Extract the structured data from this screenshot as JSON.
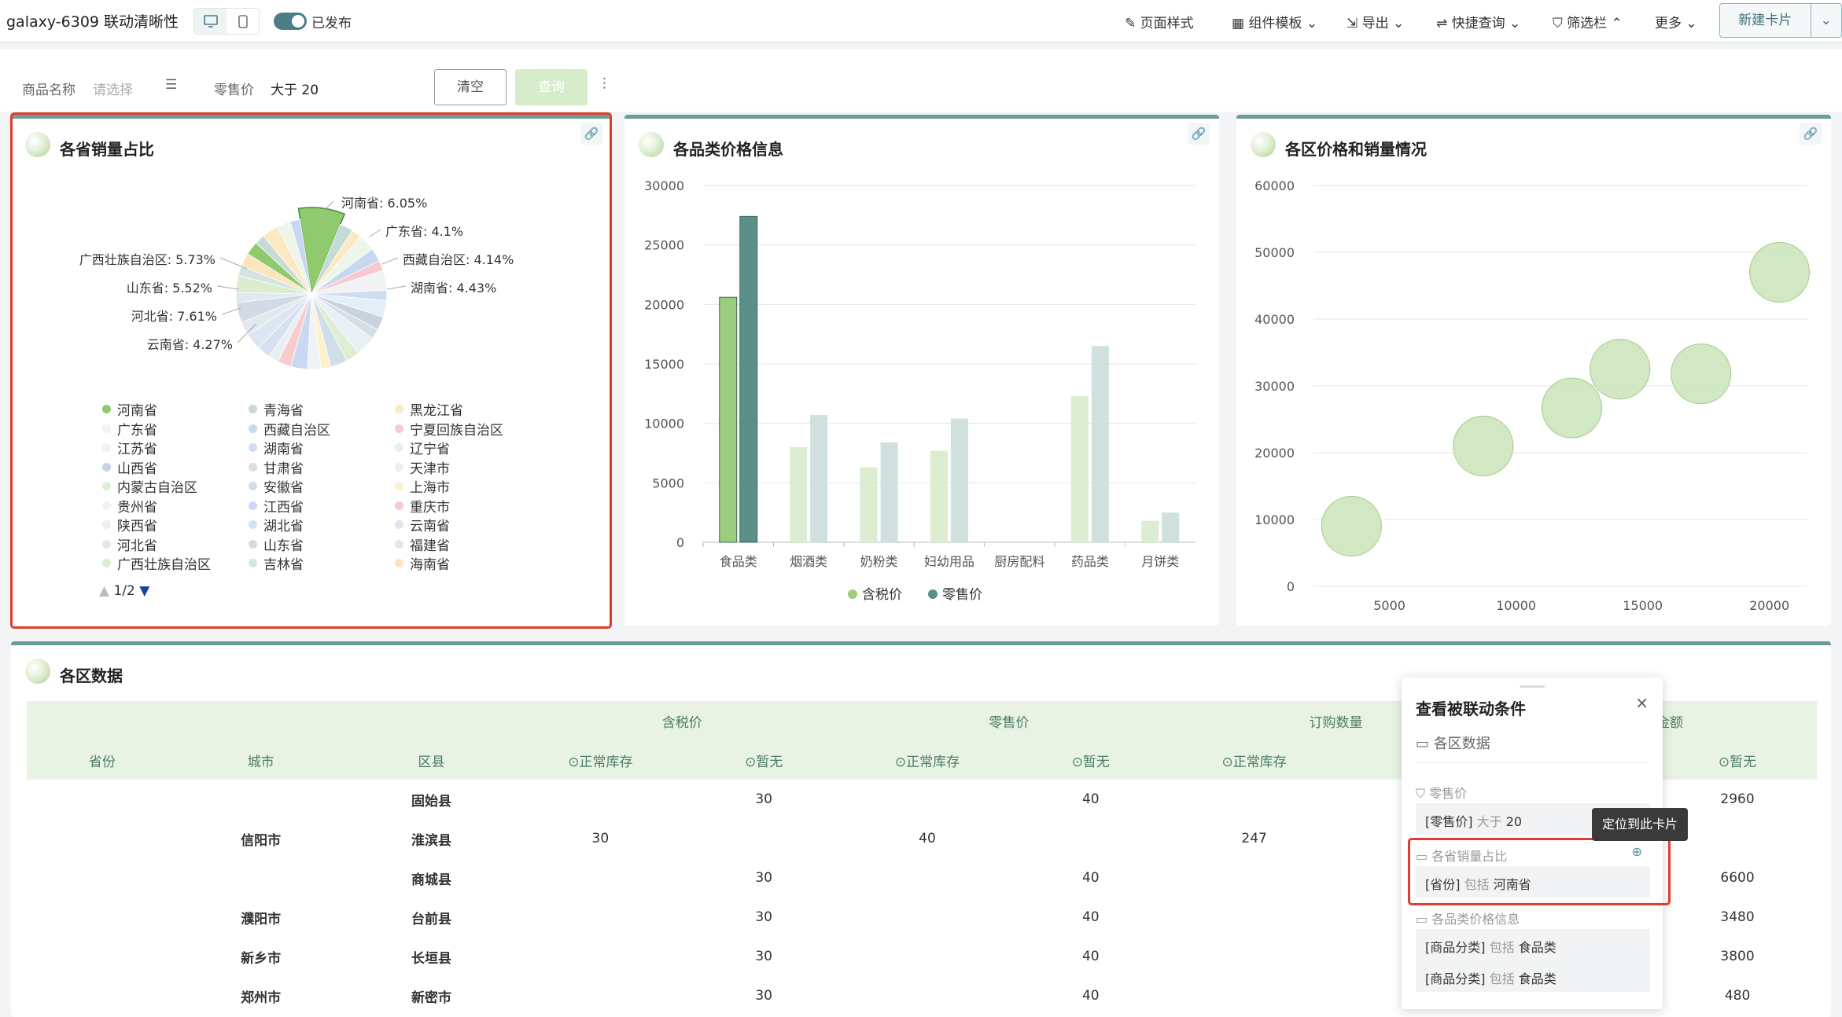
{
  "topbar": {
    "title": "galaxy-6309 联动清晰性",
    "publish_label": "已发布",
    "page_style": "页面样式",
    "component_template": "组件模板",
    "export": "导出",
    "quick_query": "快捷查询",
    "filter_bar": "筛选栏",
    "more": "更多",
    "new_card": "新建卡片"
  },
  "filters": {
    "product_name_label": "商品名称",
    "product_name_placeholder": "请选择",
    "retail_label": "零售价",
    "retail_value": "大于 20",
    "clear": "清空",
    "query": "查询"
  },
  "pie_card": {
    "title": "各省销量占比",
    "labels": [
      "河南省: 6.05%",
      "广东省: 4.1%",
      "西藏自治区: 4.14%",
      "湖南省: 4.43%",
      "广西壮族自治区: 5.73%",
      "山东省: 5.52%",
      "河北省: 7.61%",
      "云南省: 4.27%"
    ],
    "legend": [
      {
        "name": "河南省",
        "color": "#8fca6f"
      },
      {
        "name": "青海省",
        "color": "#c7dbd6"
      },
      {
        "name": "黑龙江省",
        "color": "#fce8c2"
      },
      {
        "name": "广东省",
        "color": "#eef5ea"
      },
      {
        "name": "西藏自治区",
        "color": "#c8d8f0"
      },
      {
        "name": "宁夏回族自治区",
        "color": "#f8c9cf"
      },
      {
        "name": "江苏省",
        "color": "#f0f2f3"
      },
      {
        "name": "湖南省",
        "color": "#cfdcf2"
      },
      {
        "name": "辽宁省",
        "color": "#e3eef6"
      },
      {
        "name": "山西省",
        "color": "#c8d3df"
      },
      {
        "name": "甘肃省",
        "color": "#d7dfe6"
      },
      {
        "name": "天津市",
        "color": "#e8f0f6"
      },
      {
        "name": "内蒙古自治区",
        "color": "#dcefd2"
      },
      {
        "name": "安徽省",
        "color": "#d0dee8"
      },
      {
        "name": "上海市",
        "color": "#fdf0cc"
      },
      {
        "name": "贵州省",
        "color": "#eff3f6"
      },
      {
        "name": "江西省",
        "color": "#c9d8f3"
      },
      {
        "name": "重庆市",
        "color": "#f6cccd"
      },
      {
        "name": "陕西省",
        "color": "#e9eff4"
      },
      {
        "name": "湖北省",
        "color": "#d5e1f0"
      },
      {
        "name": "云南省",
        "color": "#dbe6f2"
      },
      {
        "name": "河北省",
        "color": "#e1e9ef"
      },
      {
        "name": "山东省",
        "color": "#d2dbe5"
      },
      {
        "name": "福建省",
        "color": "#e0e8f0"
      },
      {
        "name": "广西壮族自治区",
        "color": "#dbeccf"
      },
      {
        "name": "吉林省",
        "color": "#d4e4e0"
      },
      {
        "name": "海南省",
        "color": "#fce4bd"
      }
    ],
    "pager": "1/2"
  },
  "bar_card": {
    "title": "各品类价格信息"
  },
  "scatter_card": {
    "title": "各区价格和销量情况"
  },
  "chart_data": [
    {
      "type": "pie",
      "title": "各省销量占比",
      "slices": [
        {
          "name": "河南省",
          "value": 6.05
        },
        {
          "name": "广东省",
          "value": 4.1
        },
        {
          "name": "西藏自治区",
          "value": 4.14
        },
        {
          "name": "湖南省",
          "value": 4.43
        },
        {
          "name": "广西壮族自治区",
          "value": 5.73
        },
        {
          "name": "山东省",
          "value": 5.52
        },
        {
          "name": "河北省",
          "value": 7.61
        },
        {
          "name": "云南省",
          "value": 4.27
        }
      ]
    },
    {
      "type": "bar",
      "title": "各品类价格信息",
      "categories": [
        "食品类",
        "烟酒类",
        "奶粉类",
        "妇幼用品",
        "厨房配料",
        "药品类",
        "月饼类"
      ],
      "series": [
        {
          "name": "含税价",
          "color": "#9ccc7e",
          "values": [
            20600,
            8000,
            6300,
            7700,
            0,
            12300,
            1800
          ]
        },
        {
          "name": "零售价",
          "color": "#5b8f88",
          "values": [
            27400,
            10700,
            8400,
            10400,
            0,
            16500,
            2500
          ]
        }
      ],
      "ylim": [
        0,
        30000
      ],
      "yticks": [
        0,
        5000,
        10000,
        15000,
        20000,
        25000,
        30000
      ]
    },
    {
      "type": "scatter",
      "title": "各区价格和销量情况",
      "points": [
        {
          "x": 3500,
          "y": 9000
        },
        {
          "x": 8700,
          "y": 21000
        },
        {
          "x": 12200,
          "y": 26700
        },
        {
          "x": 14100,
          "y": 32500
        },
        {
          "x": 17300,
          "y": 31800
        },
        {
          "x": 20400,
          "y": 47000
        }
      ],
      "xlim": [
        2000,
        21500
      ],
      "ylim": [
        0,
        60000
      ],
      "xticks": [
        5000,
        10000,
        15000,
        20000
      ],
      "yticks": [
        0,
        10000,
        20000,
        30000,
        40000,
        50000,
        60000
      ]
    }
  ],
  "table_card": {
    "title": "各区数据",
    "group_headers": [
      "含税价",
      "零售价",
      "订购数量",
      "金额"
    ],
    "headers": [
      "省份",
      "城市",
      "区县",
      "⊙正常库存",
      "⊙暂无",
      "⊙正常库存",
      "⊙暂无",
      "⊙正常库存",
      "⊙暂无"
    ],
    "rows": [
      {
        "city": "",
        "county": "固始县",
        "c1": "",
        "c2": "30",
        "c3": "",
        "c4": "40",
        "c5": "",
        "c6": "2960"
      },
      {
        "city": "信阳市",
        "county": "淮滨县",
        "c1": "30",
        "c2": "",
        "c3": "40",
        "c4": "",
        "c5": "247",
        "c6": ""
      },
      {
        "city": "",
        "county": "商城县",
        "c1": "",
        "c2": "30",
        "c3": "",
        "c4": "40",
        "c5": "",
        "c6": "6600"
      },
      {
        "city": "濮阳市",
        "county": "台前县",
        "c1": "",
        "c2": "30",
        "c3": "",
        "c4": "40",
        "c5": "",
        "c6": "3480"
      },
      {
        "city": "新乡市",
        "county": "长垣县",
        "c1": "",
        "c2": "30",
        "c3": "",
        "c4": "40",
        "c5": "",
        "c6": "3800"
      },
      {
        "city": "郑州市",
        "county": "新密市",
        "c1": "",
        "c2": "30",
        "c3": "",
        "c4": "40",
        "c5": "",
        "c6": "480"
      }
    ]
  },
  "popup": {
    "title": "查看被联动条件",
    "target": "各区数据",
    "group1": "零售价",
    "cond1_field": "[零售价]",
    "cond1_op": "大于",
    "cond1_val": "20",
    "group2": "各省销量占比",
    "cond2_field": "[省份]",
    "cond2_op": "包括",
    "cond2_val": "河南省",
    "group3": "各品类价格信息",
    "cond3_field": "[商品分类]",
    "cond3_op": "包括",
    "cond3_val": "食品类",
    "cond4_field": "[商品分类]",
    "cond4_op": "包括",
    "cond4_val": "食品类",
    "tooltip": "定位到此卡片"
  }
}
